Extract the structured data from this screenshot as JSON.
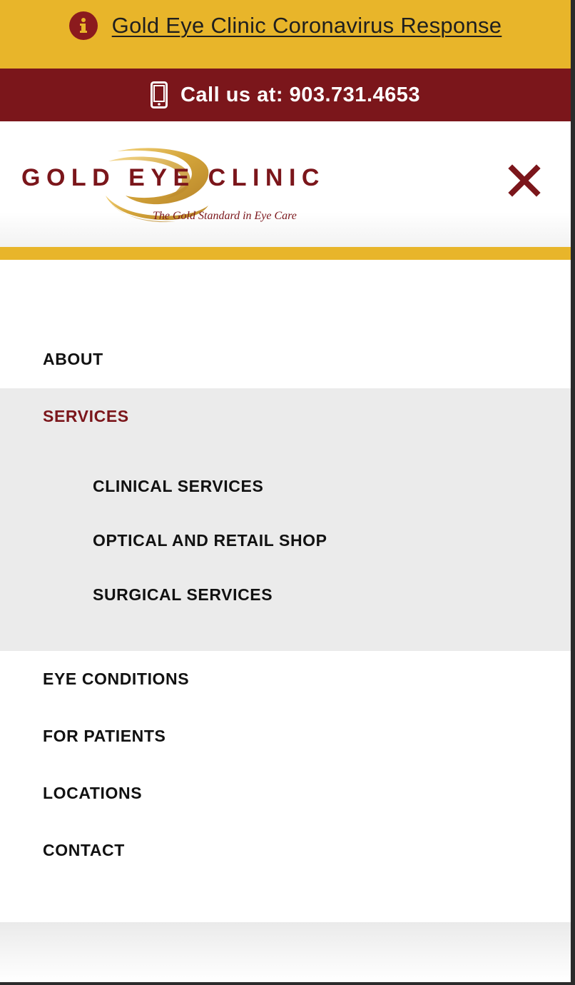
{
  "alert": {
    "icon": "info-icon",
    "text": "Gold Eye Clinic Coronavirus Response"
  },
  "call": {
    "icon": "mobile-phone-icon",
    "text": "Call us at: 903.731.4653"
  },
  "logo": {
    "name": "GOLD EYE CLINIC",
    "tagline": "The Gold Standard in Eye Care"
  },
  "close": {
    "icon": "close-icon"
  },
  "nav": {
    "items": [
      {
        "label": "ABOUT"
      },
      {
        "label": "SERVICES"
      },
      {
        "label": "EYE CONDITIONS"
      },
      {
        "label": "FOR PATIENTS"
      },
      {
        "label": "LOCATIONS"
      },
      {
        "label": "CONTACT"
      }
    ],
    "services_sub": [
      {
        "label": "CLINICAL SERVICES"
      },
      {
        "label": "OPTICAL AND RETAIL SHOP"
      },
      {
        "label": "SURGICAL SERVICES"
      }
    ]
  },
  "colors": {
    "gold": "#e8b52a",
    "maroon": "#7b161b",
    "panel_gray": "#ebebeb",
    "text": "#111111"
  }
}
